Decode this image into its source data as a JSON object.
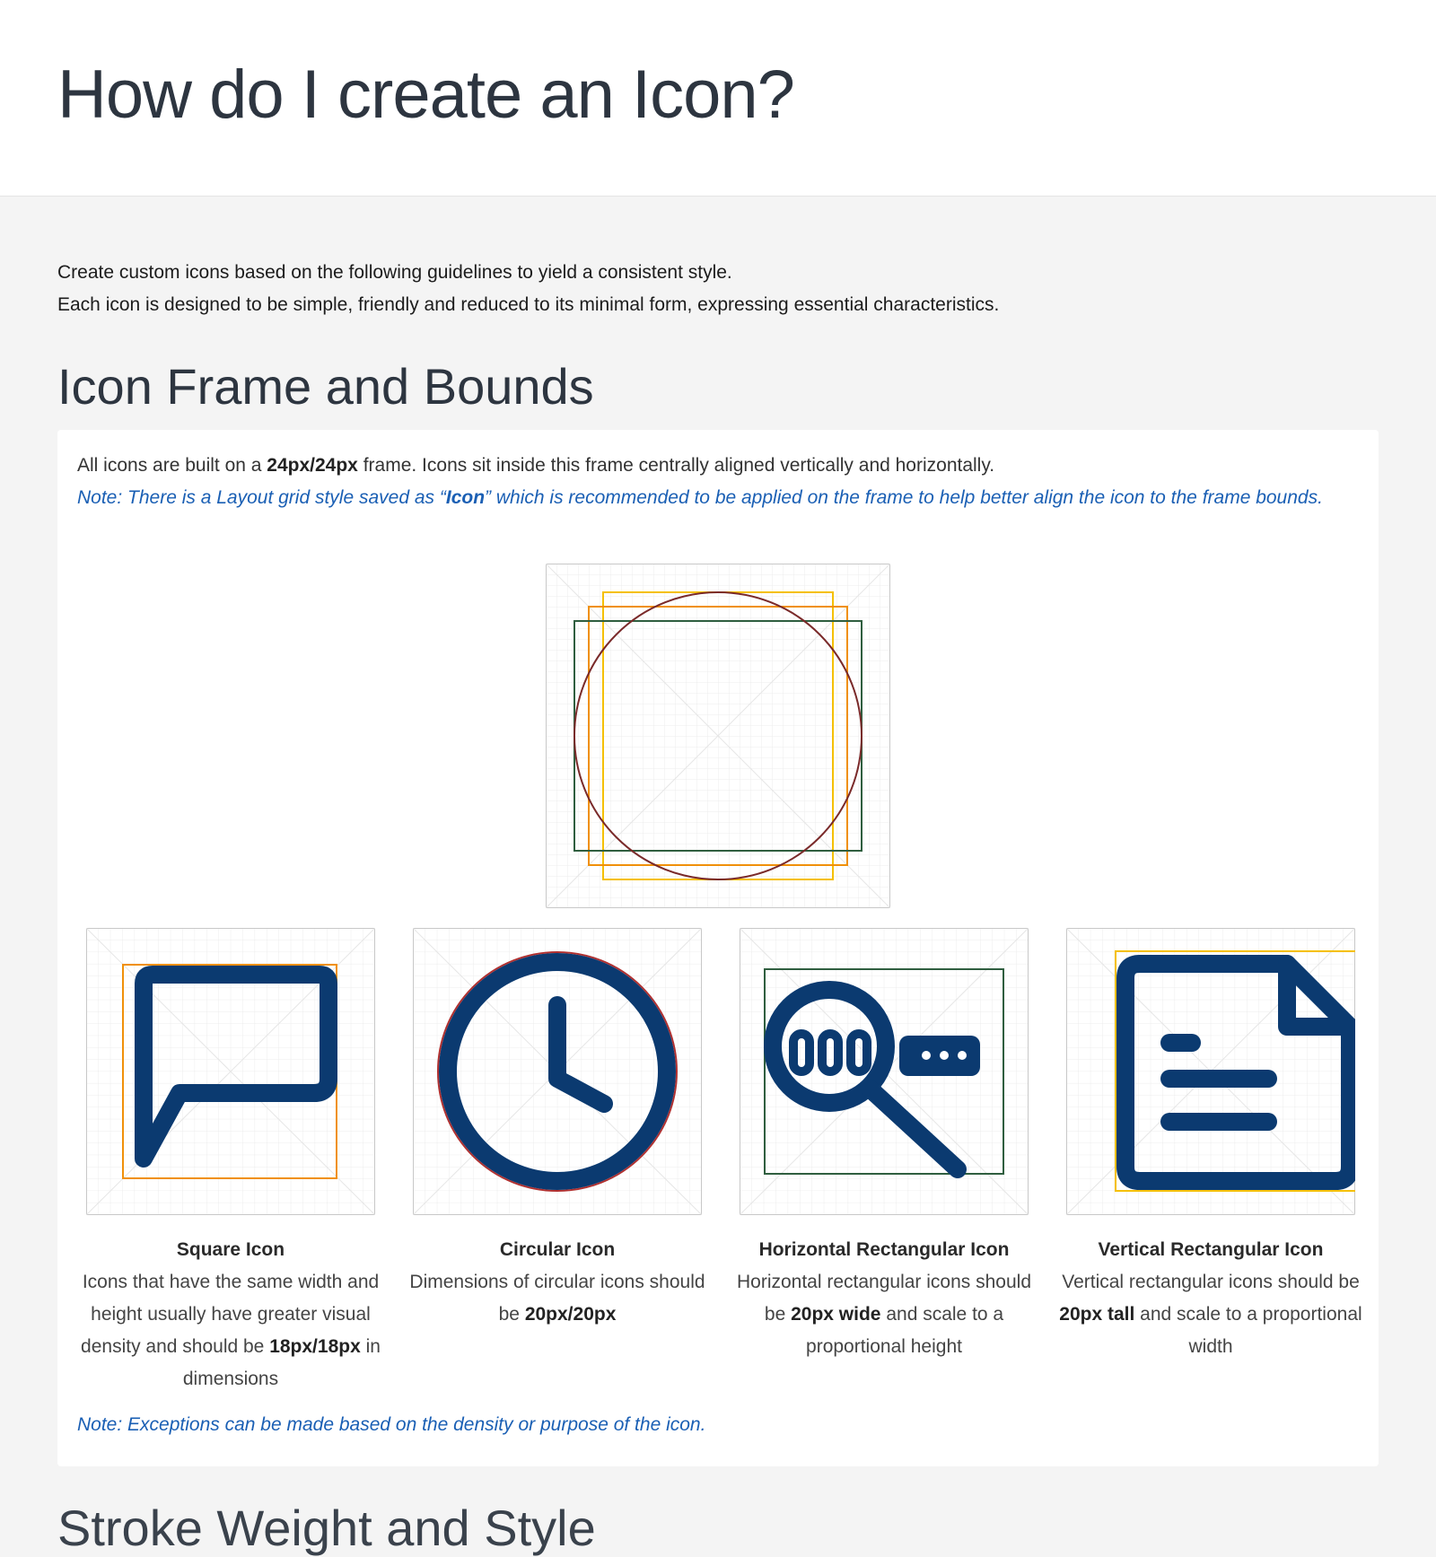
{
  "header": {
    "title": "How do I create an Icon?"
  },
  "intro": {
    "line1": "Create custom icons based on the following guidelines to yield a consistent style.",
    "line2": "Each icon is designed to be simple, friendly and reduced to its minimal form, expressing essential characteristics."
  },
  "frame_section": {
    "heading": "Icon Frame and Bounds",
    "text_pre": "All icons are built on a ",
    "text_bold": "24px/24px",
    "text_post": " frame. Icons sit inside this frame centrally aligned vertically and horizontally.",
    "note_pre": "Note: There is a Layout grid style saved as “",
    "note_bold": "Icon",
    "note_post": "” which is recommended to be applied on the frame to help better align the icon to the frame bounds.",
    "icons": [
      {
        "icon": "chat-bubble-icon",
        "title": "Square Icon",
        "d1": "Icons that have the same width and height usually have greater visual density and  should be ",
        "bold": "18px/18px",
        "d2": " in dimensions"
      },
      {
        "icon": "clock-icon",
        "title": "Circular Icon",
        "d1": "Dimensions of circular icons should be ",
        "bold": "20px/20px",
        "d2": ""
      },
      {
        "icon": "password-search-icon",
        "title": "Horizontal Rectangular Icon",
        "d1": "Horizontal rectangular icons should be ",
        "bold": "20px wide",
        "d2": " and scale to a proportional height"
      },
      {
        "icon": "document-icon",
        "title": "Vertical Rectangular Icon",
        "d1": "Vertical rectangular icons should be ",
        "bold": "20px tall",
        "d2": " and scale to a proportional width"
      }
    ],
    "note2": "Note: Exceptions can be made based on the density or purpose of the icon."
  },
  "next_section": {
    "heading": "Stroke Weight and Style"
  },
  "colors": {
    "icon_navy": "#0b3a70",
    "note_blue": "#1a5fb4",
    "keyline_yellow": "#f5c000",
    "keyline_orange": "#f0900a",
    "keyline_green": "#2f5e3f",
    "keyline_circle": "#7a2a2a"
  }
}
